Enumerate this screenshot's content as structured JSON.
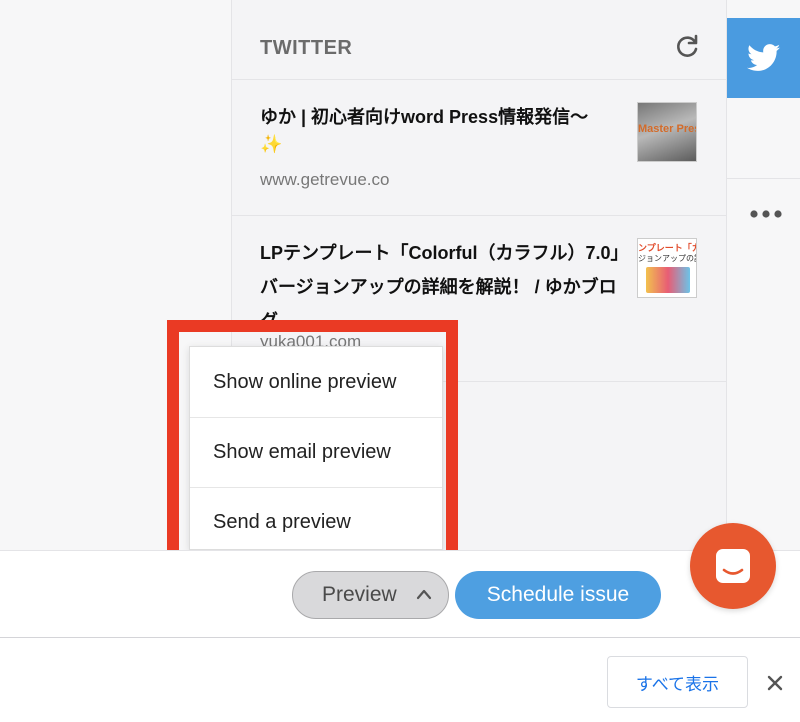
{
  "panel": {
    "title": "TWITTER",
    "items": [
      {
        "title": "ゆか | 初心者向けword Press情報発信〜",
        "sparkle": "✨",
        "domain": "www.getrevue.co",
        "thumb_text": "Master Press"
      },
      {
        "title": "LPテンプレート「Colorful（カラフル）7.0」バージョンアップの詳細を解説！ / ゆかブログ",
        "domain": "yuka001.com",
        "thumb_top_text": "ンプレート「カラフル",
        "thumb_mid_text": "ジョンアップの詳細"
      }
    ]
  },
  "dropdown": {
    "items": [
      "Show online preview",
      "Show email preview",
      "Send a preview"
    ]
  },
  "bottom_bar": {
    "preview_label": "Preview",
    "schedule_label": "Schedule issue"
  },
  "footer": {
    "show_all_label": "すべて表示"
  },
  "colors": {
    "twitter_blue": "#4a9be0",
    "schedule_blue": "#4e9fe1",
    "chat_orange": "#e7582f",
    "highlight_red": "#ea3a24"
  },
  "icons": {
    "refresh": "refresh-icon",
    "twitter": "twitter-bird-icon",
    "more": "more-horizontal-icon",
    "caret": "chevron-up-icon",
    "chat": "chat-icon",
    "close": "close-icon"
  }
}
